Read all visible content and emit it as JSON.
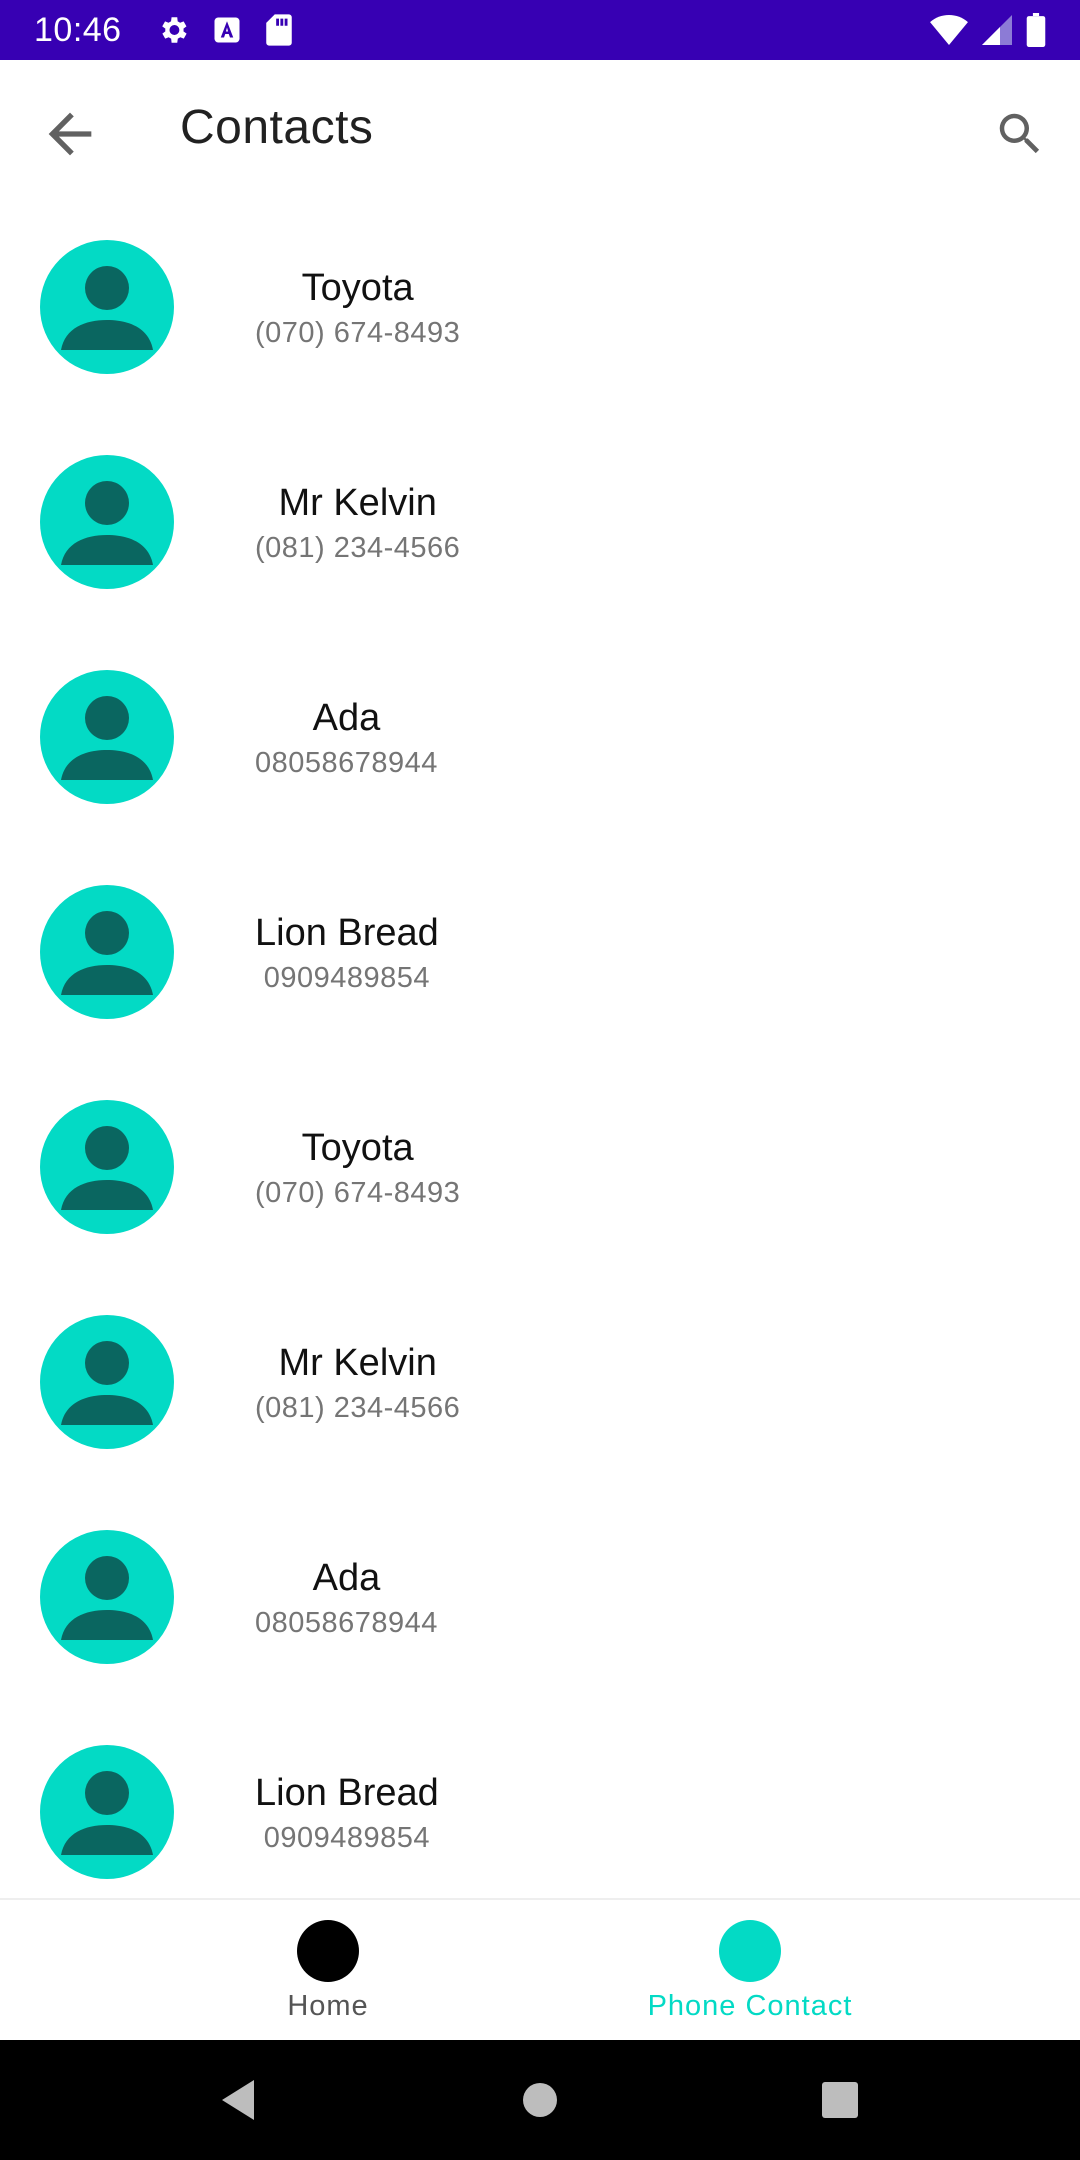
{
  "status_bar": {
    "time": "10:46",
    "left_icons": [
      "settings-icon",
      "a-badge-icon",
      "sd-card-icon"
    ],
    "right_icons": [
      "wifi-icon",
      "signal-icon",
      "battery-icon"
    ],
    "background": "#3700B3"
  },
  "app_bar": {
    "title": "Contacts",
    "back_icon": "arrow-left-icon",
    "search_icon": "search-icon"
  },
  "contacts": [
    {
      "name": "Toyota",
      "phone": "(070) 674-8493"
    },
    {
      "name": "Mr Kelvin",
      "phone": "(081) 234-4566"
    },
    {
      "name": "Ada",
      "phone": "08058678944"
    },
    {
      "name": "Lion Bread",
      "phone": "0909489854"
    },
    {
      "name": "Toyota",
      "phone": "(070) 674-8493"
    },
    {
      "name": "Mr Kelvin",
      "phone": "(081) 234-4566"
    },
    {
      "name": "Ada",
      "phone": "08058678944"
    },
    {
      "name": "Lion Bread",
      "phone": "0909489854"
    }
  ],
  "avatar": {
    "background": "#03DAC5",
    "icon_color": "#0A6660",
    "icon": "person-icon"
  },
  "bottom_nav": {
    "items": [
      {
        "label": "Home",
        "color": "#000000",
        "label_color": "#555555",
        "selected": false
      },
      {
        "label": "Phone Contact",
        "color": "#03DAC5",
        "label_color": "#03DAC5",
        "selected": true
      }
    ]
  },
  "system_nav": {
    "buttons": [
      "back-triangle-icon",
      "home-circle-icon",
      "recents-square-icon"
    ]
  }
}
